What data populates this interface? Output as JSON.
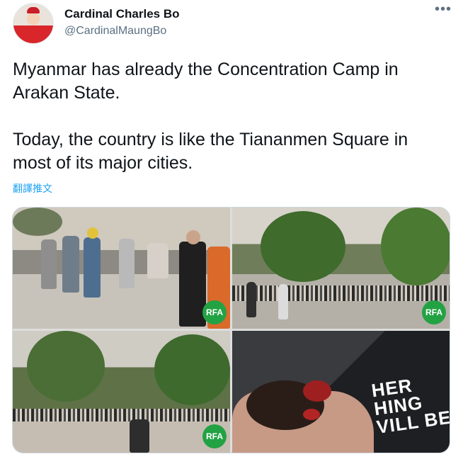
{
  "author": {
    "name": "Cardinal Charles Bo",
    "handle": "@CardinalMaungBo"
  },
  "menu_icon": "more-horizontal-icon",
  "tweet": {
    "text": "Myanmar has already the Concentration Camp in Arakan State.\n\nToday, the country is like the Tiananmen Square in most of its major cities.",
    "translate_label": "翻譯推文"
  },
  "media": {
    "watermark": "RFA",
    "shirt_text": "HER\nHING\nVILL BE",
    "colors": {
      "watermark_green": "#23a244",
      "link_blue": "#1da1f2"
    }
  }
}
